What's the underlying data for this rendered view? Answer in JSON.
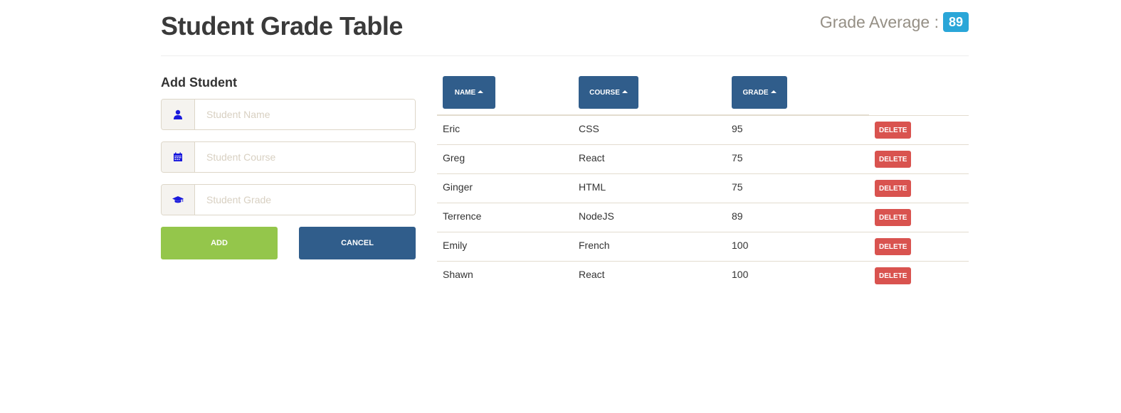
{
  "header": {
    "title": "Student Grade Table",
    "average_label": "Grade Average :",
    "average_value": "89"
  },
  "form": {
    "title": "Add Student",
    "fields": [
      {
        "icon": "user-icon",
        "placeholder": "Student Name",
        "value": ""
      },
      {
        "icon": "calendar-icon",
        "placeholder": "Student Course",
        "value": ""
      },
      {
        "icon": "graduation-cap-icon",
        "placeholder": "Student Grade",
        "value": ""
      }
    ],
    "add_label": "ADD",
    "cancel_label": "CANCEL"
  },
  "table": {
    "columns": [
      {
        "label": "NAME",
        "sort": "ascending"
      },
      {
        "label": "COURSE",
        "sort": "ascending"
      },
      {
        "label": "GRADE",
        "sort": "ascending"
      }
    ],
    "rows": [
      {
        "name": "Eric",
        "course": "CSS",
        "grade": "95",
        "action": "DELETE"
      },
      {
        "name": "Greg",
        "course": "React",
        "grade": "75",
        "action": "DELETE"
      },
      {
        "name": "Ginger",
        "course": "HTML",
        "grade": "75",
        "action": "DELETE"
      },
      {
        "name": "Terrence",
        "course": "NodeJS",
        "grade": "89",
        "action": "DELETE"
      },
      {
        "name": "Emily",
        "course": "French",
        "grade": "100",
        "action": "DELETE"
      },
      {
        "name": "Shawn",
        "course": "React",
        "grade": "100",
        "action": "DELETE"
      }
    ]
  },
  "colors": {
    "primary": "#305d8b",
    "success": "#94c64b",
    "danger": "#d9534f",
    "info_badge": "#2aa6d8",
    "icon": "#1a1adc"
  }
}
